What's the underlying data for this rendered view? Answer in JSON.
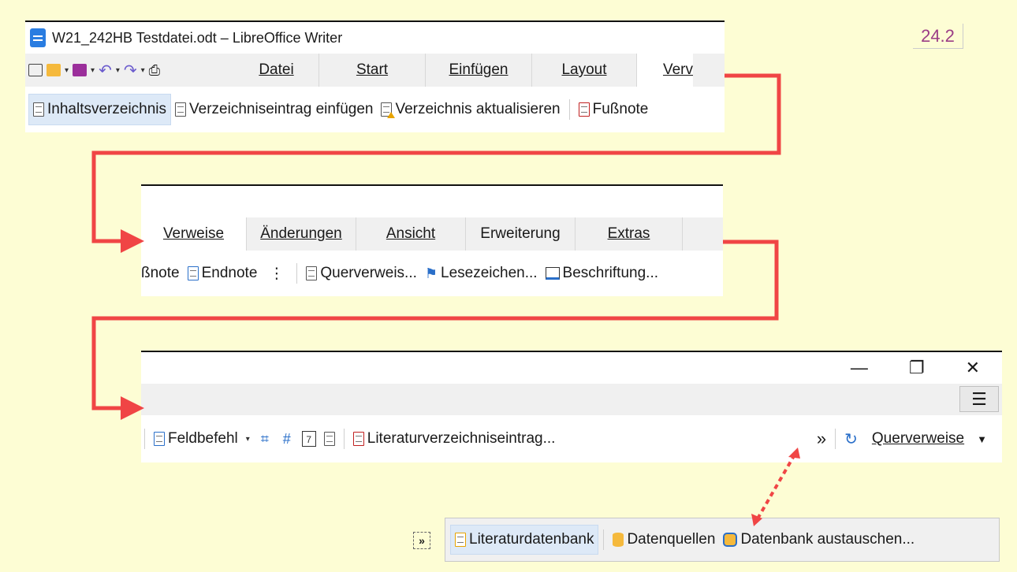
{
  "version_label": "24.2",
  "panel1": {
    "window_title": "W21_242HB Testdatei.odt – LibreOffice Writer",
    "tabs": [
      {
        "label": "Datei"
      },
      {
        "label": "Start"
      },
      {
        "label": "Einfügen"
      },
      {
        "label": "Layout"
      },
      {
        "label": "Verv"
      }
    ],
    "toolbar": {
      "inhaltsverzeichnis": "Inhaltsverzeichnis",
      "verzeichniseintrag": "Verzeichniseintrag einfügen",
      "verzeichnis_aktualisieren": "Verzeichnis aktualisieren",
      "fussnote": "Fußnote"
    }
  },
  "panel2": {
    "tabs": [
      {
        "label": "Verweise"
      },
      {
        "label": "Änderungen"
      },
      {
        "label": "Ansicht"
      },
      {
        "label": "Erweiterung"
      },
      {
        "label": "Extras"
      }
    ],
    "toolbar": {
      "fussnote_partial": "ßnote",
      "endnote": "Endnote",
      "more": "⋮",
      "querverweis": "Querverweis...",
      "lesezeichen": "Lesezeichen...",
      "beschriftung": "Beschriftung..."
    }
  },
  "panel3": {
    "window_controls": {
      "minimize": "—",
      "restore": "❐",
      "close": "✕"
    },
    "menu_icon": "☰",
    "toolbar": {
      "feldbefehl": "Feldbefehl",
      "literaturverzeichniseintrag": "Literaturverzeichniseintrag...",
      "overflow": "»",
      "querverweise": "Querverweise"
    }
  },
  "panel4": {
    "toolbar": {
      "literaturdatenbank": "Literaturdatenbank",
      "datenquellen": "Datenquellen",
      "datenbank_austauschen": "Datenbank austauschen..."
    },
    "expand_icon": "»"
  },
  "colors": {
    "background": "#fdfdd4",
    "arrow": "#f04545",
    "version_text": "#9b3d86",
    "selected_button": "#dde9f7"
  }
}
